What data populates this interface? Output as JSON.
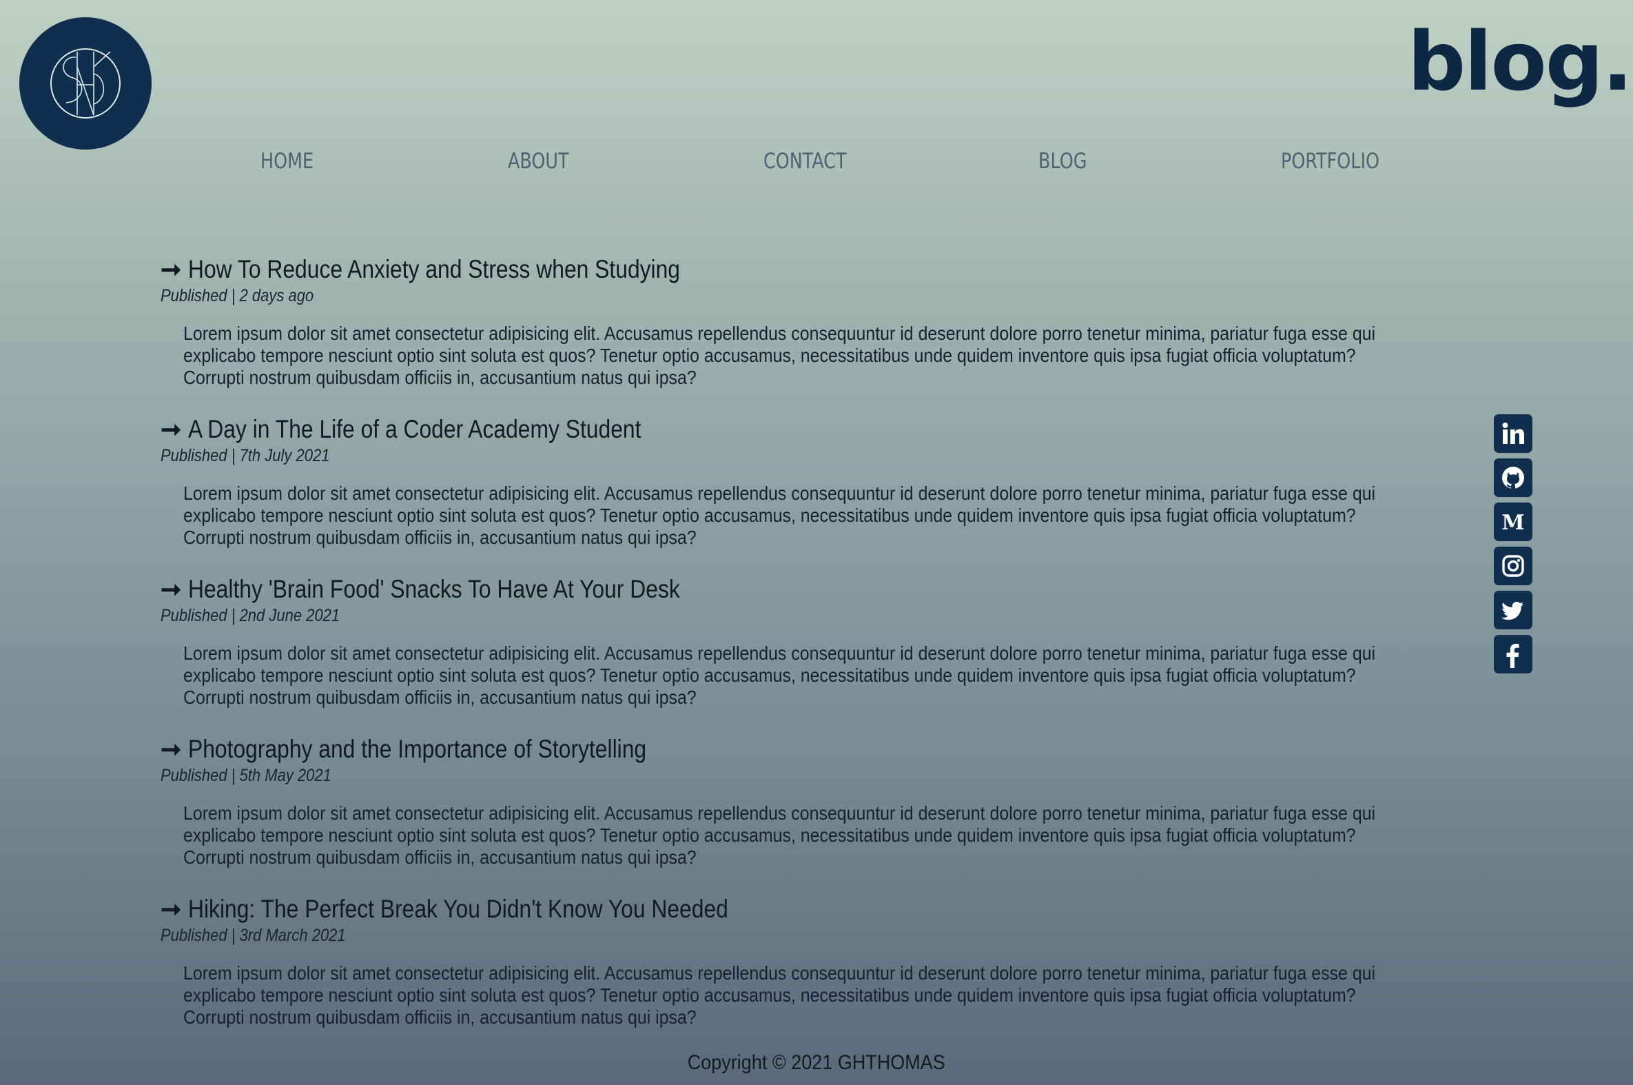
{
  "header": {
    "brand": "blog."
  },
  "nav": {
    "items": [
      {
        "label": "HOME"
      },
      {
        "label": "ABOUT"
      },
      {
        "label": "CONTACT"
      },
      {
        "label": "BLOG"
      },
      {
        "label": "PORTFOLIO"
      }
    ]
  },
  "posts": [
    {
      "arrow": "➞",
      "title": "How To Reduce Anxiety and Stress when Studying",
      "meta": "Published | 2 days ago",
      "body": "Lorem ipsum dolor sit amet consectetur adipisicing elit. Accusamus repellendus consequuntur id deserunt dolore porro tenetur minima, pariatur fuga esse qui explicabo tempore nesciunt optio sint soluta est quos? Tenetur optio accusamus, necessitatibus unde quidem inventore quis ipsa fugiat officia voluptatum? Corrupti nostrum quibusdam officiis in, accusantium natus qui ipsa?"
    },
    {
      "arrow": "➞",
      "title": "A Day in The Life of a Coder Academy Student",
      "meta": "Published | 7th July 2021",
      "body": "Lorem ipsum dolor sit amet consectetur adipisicing elit. Accusamus repellendus consequuntur id deserunt dolore porro tenetur minima, pariatur fuga esse qui explicabo tempore nesciunt optio sint soluta est quos? Tenetur optio accusamus, necessitatibus unde quidem inventore quis ipsa fugiat officia voluptatum? Corrupti nostrum quibusdam officiis in, accusantium natus qui ipsa?"
    },
    {
      "arrow": "➞",
      "title": "Healthy 'Brain Food' Snacks To Have At Your Desk",
      "meta": "Published | 2nd June 2021",
      "body": "Lorem ipsum dolor sit amet consectetur adipisicing elit. Accusamus repellendus consequuntur id deserunt dolore porro tenetur minima, pariatur fuga esse qui explicabo tempore nesciunt optio sint soluta est quos? Tenetur optio accusamus, necessitatibus unde quidem inventore quis ipsa fugiat officia voluptatum? Corrupti nostrum quibusdam officiis in, accusantium natus qui ipsa?"
    },
    {
      "arrow": "➞",
      "title": "Photography and the Importance of Storytelling",
      "meta": "Published | 5th May 2021",
      "body": "Lorem ipsum dolor sit amet consectetur adipisicing elit. Accusamus repellendus consequuntur id deserunt dolore porro tenetur minima, pariatur fuga esse qui explicabo tempore nesciunt optio sint soluta est quos? Tenetur optio accusamus, necessitatibus unde quidem inventore quis ipsa fugiat officia voluptatum? Corrupti nostrum quibusdam officiis in, accusantium natus qui ipsa?"
    },
    {
      "arrow": "➞",
      "title": "Hiking: The Perfect Break You Didn't Know You Needed",
      "meta": "Published | 3rd March 2021",
      "body": "Lorem ipsum dolor sit amet consectetur adipisicing elit. Accusamus repellendus consequuntur id deserunt dolore porro tenetur minima, pariatur fuga esse qui explicabo tempore nesciunt optio sint soluta est quos? Tenetur optio accusamus, necessitatibus unde quidem inventore quis ipsa fugiat officia voluptatum? Corrupti nostrum quibusdam officiis in, accusantium natus qui ipsa?"
    }
  ],
  "social": {
    "icons": [
      "linkedin-icon",
      "github-icon",
      "medium-icon",
      "instagram-icon",
      "twitter-icon",
      "facebook-icon"
    ]
  },
  "footer": {
    "copyright": "Copyright © 2021 GHTHOMAS"
  },
  "colors": {
    "brand_navy": "#102f4f",
    "nav_text": "#4c6470",
    "gradient_top": "#bdd1c6",
    "gradient_bottom": "#5a6a79"
  }
}
